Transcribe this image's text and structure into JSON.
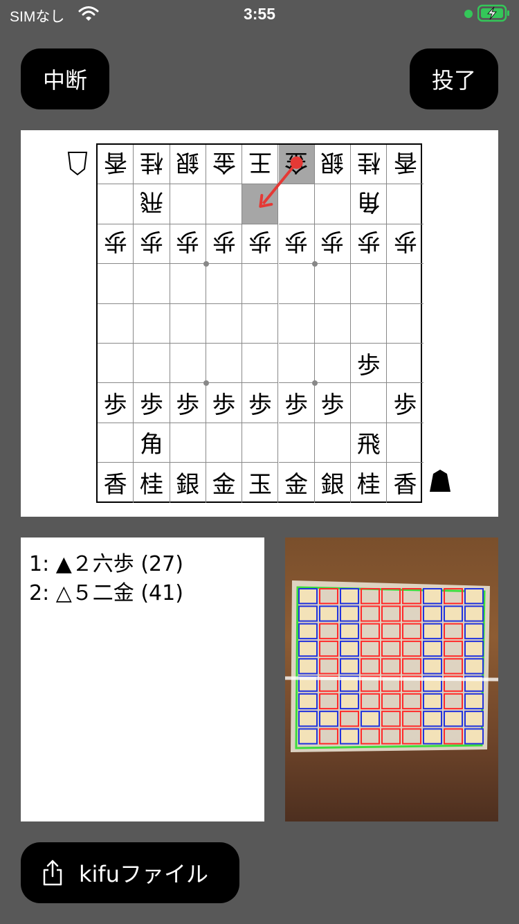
{
  "status_bar": {
    "carrier": "SIMなし",
    "time": "3:55"
  },
  "toolbar": {
    "pause_label": "中断",
    "resign_label": "投了"
  },
  "board": {
    "rows": [
      [
        {
          "p": "香",
          "o": "gote"
        },
        {
          "p": "桂",
          "o": "gote"
        },
        {
          "p": "銀",
          "o": "gote"
        },
        {
          "p": "金",
          "o": "gote"
        },
        {
          "p": "王",
          "o": "gote"
        },
        {
          "p": "金",
          "o": "gote"
        },
        {
          "p": "銀",
          "o": "gote"
        },
        {
          "p": "桂",
          "o": "gote"
        },
        {
          "p": "香",
          "o": "gote"
        }
      ],
      [
        {
          "p": "",
          "o": ""
        },
        {
          "p": "飛",
          "o": "gote"
        },
        {
          "p": "",
          "o": ""
        },
        {
          "p": "",
          "o": ""
        },
        {
          "p": "",
          "o": ""
        },
        {
          "p": "",
          "o": ""
        },
        {
          "p": "",
          "o": ""
        },
        {
          "p": "角",
          "o": "gote"
        },
        {
          "p": "",
          "o": ""
        }
      ],
      [
        {
          "p": "歩",
          "o": "gote"
        },
        {
          "p": "歩",
          "o": "gote"
        },
        {
          "p": "歩",
          "o": "gote"
        },
        {
          "p": "歩",
          "o": "gote"
        },
        {
          "p": "歩",
          "o": "gote"
        },
        {
          "p": "歩",
          "o": "gote"
        },
        {
          "p": "歩",
          "o": "gote"
        },
        {
          "p": "歩",
          "o": "gote"
        },
        {
          "p": "歩",
          "o": "gote"
        }
      ],
      [
        {
          "p": "",
          "o": ""
        },
        {
          "p": "",
          "o": ""
        },
        {
          "p": "",
          "o": ""
        },
        {
          "p": "",
          "o": ""
        },
        {
          "p": "",
          "o": ""
        },
        {
          "p": "",
          "o": ""
        },
        {
          "p": "",
          "o": ""
        },
        {
          "p": "",
          "o": ""
        },
        {
          "p": "",
          "o": ""
        }
      ],
      [
        {
          "p": "",
          "o": ""
        },
        {
          "p": "",
          "o": ""
        },
        {
          "p": "",
          "o": ""
        },
        {
          "p": "",
          "o": ""
        },
        {
          "p": "",
          "o": ""
        },
        {
          "p": "",
          "o": ""
        },
        {
          "p": "",
          "o": ""
        },
        {
          "p": "",
          "o": ""
        },
        {
          "p": "",
          "o": ""
        }
      ],
      [
        {
          "p": "",
          "o": ""
        },
        {
          "p": "",
          "o": ""
        },
        {
          "p": "",
          "o": ""
        },
        {
          "p": "",
          "o": ""
        },
        {
          "p": "",
          "o": ""
        },
        {
          "p": "",
          "o": ""
        },
        {
          "p": "",
          "o": ""
        },
        {
          "p": "歩",
          "o": "sente"
        },
        {
          "p": "",
          "o": ""
        }
      ],
      [
        {
          "p": "歩",
          "o": "sente"
        },
        {
          "p": "歩",
          "o": "sente"
        },
        {
          "p": "歩",
          "o": "sente"
        },
        {
          "p": "歩",
          "o": "sente"
        },
        {
          "p": "歩",
          "o": "sente"
        },
        {
          "p": "歩",
          "o": "sente"
        },
        {
          "p": "歩",
          "o": "sente"
        },
        {
          "p": "",
          "o": ""
        },
        {
          "p": "歩",
          "o": "sente"
        }
      ],
      [
        {
          "p": "",
          "o": ""
        },
        {
          "p": "角",
          "o": "sente"
        },
        {
          "p": "",
          "o": ""
        },
        {
          "p": "",
          "o": ""
        },
        {
          "p": "",
          "o": ""
        },
        {
          "p": "",
          "o": ""
        },
        {
          "p": "",
          "o": ""
        },
        {
          "p": "飛",
          "o": "sente"
        },
        {
          "p": "",
          "o": ""
        }
      ],
      [
        {
          "p": "香",
          "o": "sente"
        },
        {
          "p": "桂",
          "o": "sente"
        },
        {
          "p": "銀",
          "o": "sente"
        },
        {
          "p": "金",
          "o": "sente"
        },
        {
          "p": "玉",
          "o": "sente"
        },
        {
          "p": "金",
          "o": "sente"
        },
        {
          "p": "銀",
          "o": "sente"
        },
        {
          "p": "桂",
          "o": "sente"
        },
        {
          "p": "香",
          "o": "sente"
        }
      ]
    ],
    "highlight": [
      {
        "row": 0,
        "col": 5
      },
      {
        "row": 1,
        "col": 4
      }
    ],
    "arrow_color": "#e53935",
    "highlight_color": "#a6a6a6"
  },
  "kifu": {
    "moves": [
      "1: ▲２六歩 (27)",
      "2: △５二金 (41)"
    ]
  },
  "kifu_button": {
    "label": "kifuファイル",
    "icon": "share-icon"
  }
}
